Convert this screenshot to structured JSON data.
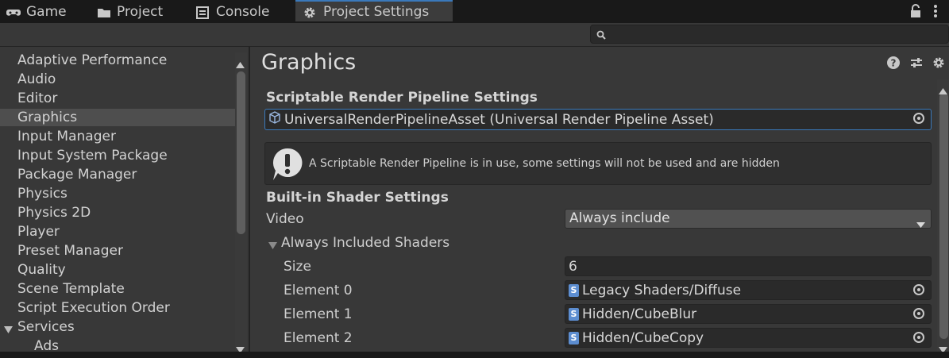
{
  "tabs": [
    {
      "label": "Game",
      "icon": "gamepad-icon"
    },
    {
      "label": "Project",
      "icon": "folder-icon"
    },
    {
      "label": "Console",
      "icon": "console-icon"
    },
    {
      "label": "Project Settings",
      "icon": "gear-icon",
      "active": true
    }
  ],
  "sidebar": {
    "items": [
      "Adaptive Performance",
      "Audio",
      "Editor",
      "Graphics",
      "Input Manager",
      "Input System Package",
      "Package Manager",
      "Physics",
      "Physics 2D",
      "Player",
      "Preset Manager",
      "Quality",
      "Scene Template",
      "Script Execution Order",
      "Services",
      "Ads"
    ],
    "selected": "Graphics"
  },
  "main": {
    "title": "Graphics",
    "srp_header": "Scriptable Render Pipeline Settings",
    "srp_asset": "UniversalRenderPipelineAsset (Universal Render Pipeline Asset)",
    "help_text": "A Scriptable Render Pipeline is in use, some settings will not be used and are hidden",
    "builtin_header": "Built-in Shader Settings",
    "video_label": "Video",
    "video_value": "Always include",
    "always_included_label": "Always Included Shaders",
    "size_label": "Size",
    "size_value": "6",
    "elements": [
      {
        "label": "Element 0",
        "value": "Legacy Shaders/Diffuse"
      },
      {
        "label": "Element 1",
        "value": "Hidden/CubeBlur"
      },
      {
        "label": "Element 2",
        "value": "Hidden/CubeCopy"
      }
    ]
  },
  "colors": {
    "accent": "#3a79bb",
    "background": "#383838",
    "tabbar": "#191919"
  }
}
